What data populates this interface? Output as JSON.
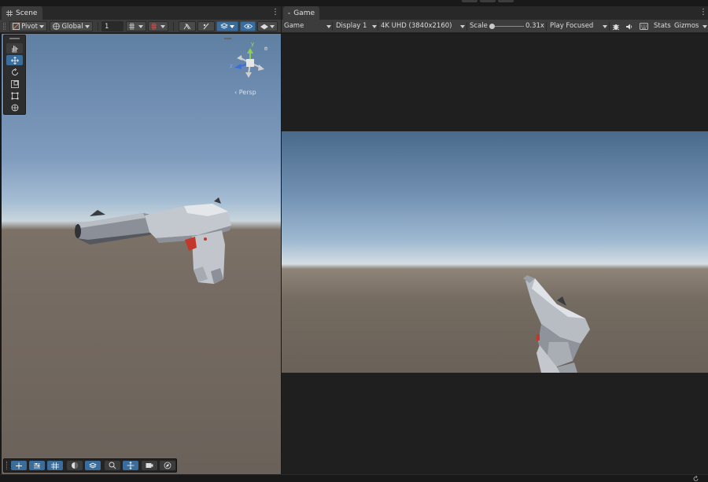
{
  "scene_panel": {
    "tab_title": "Scene",
    "tab_icon": "grid-icon",
    "toolbar": {
      "pivot_label": "Pivot",
      "global_label": "Global",
      "grid_snap_value": "1"
    },
    "overlay": {
      "gizmo_axes": {
        "y": "y",
        "z": "z"
      },
      "persp_label": "‹ Persp"
    }
  },
  "game_panel": {
    "tab_title": "Game",
    "tab_icon": "gamepad-icon",
    "toolbar": {
      "view_select": "Game",
      "display_select": "Display 1",
      "resolution_select": "4K UHD (3840x2160)",
      "scale_label": "Scale",
      "scale_value": "0.31x",
      "play_mode_select": "Play Focused",
      "stats_label": "Stats",
      "gizmos_label": "Gizmos"
    }
  },
  "colors": {
    "accent_blue": "#3a6c9c",
    "panel_bg": "#282828",
    "toolbar_bg": "#3c3c3c",
    "trigger_red": "#c0392b"
  }
}
